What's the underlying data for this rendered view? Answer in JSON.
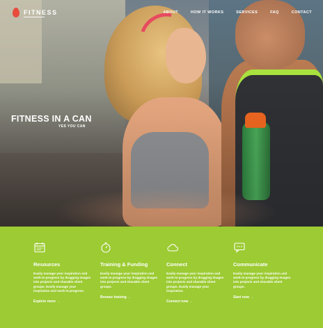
{
  "brand": {
    "name": "FITNESS",
    "accent": "#e84c3d"
  },
  "nav": {
    "items": [
      "ABOUT",
      "HOW IT WORKS",
      "SERVICES",
      "FAQ",
      "CONTACT"
    ]
  },
  "hero": {
    "title": "FITNESS IN A CAN",
    "subtitle": "YES YOU CAN"
  },
  "features": {
    "background": "#9ccb33",
    "items": [
      {
        "icon": "calendar-icon",
        "title": "Resources",
        "text": "Easily manage your inspiration and work-in-progress by dragging images into projects and sharable client groups. Easily manage your inspiration and work-in-progress.",
        "link": "Explore more  →"
      },
      {
        "icon": "stopwatch-icon",
        "title": "Training & Funding",
        "text": "Easily manage your inspiration and work-in-progress by dragging images into projects and sharable client groups.",
        "link": "Browse training  →"
      },
      {
        "icon": "cloud-icon",
        "title": "Connect",
        "text": "Easily manage your inspiration and work-in-progress by dragging images into projects and sharable client groups. Easily manage your inspiration.",
        "link": "Connect now  →"
      },
      {
        "icon": "chat-bubble-icon",
        "title": "Communicate",
        "text": "Easily manage your inspiration and work-in-progress by dragging images into projects and sharable client groups.",
        "link": "Start now  →"
      }
    ]
  }
}
